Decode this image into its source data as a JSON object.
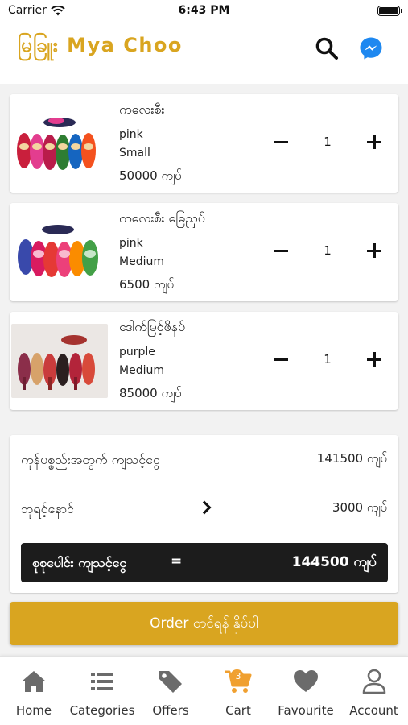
{
  "status_bar": {
    "carrier": "Carrier",
    "time": "6:43 PM"
  },
  "header": {
    "title": "မြခြူး Mya Choo"
  },
  "cart_items": [
    {
      "name": "ကလေးစီး",
      "color": "pink",
      "size": "Small",
      "price": "50000 ကျပ်",
      "quantity": "1"
    },
    {
      "name": "ကလေးစီး ခြေညှပ်",
      "color": "pink",
      "size": "Medium",
      "price": "6500 ကျပ်",
      "quantity": "1"
    },
    {
      "name": "ဒေါက်မြင့်ဖိနပ်",
      "color": "purple",
      "size": "Medium",
      "price": "85000 ကျပ်",
      "quantity": "1"
    }
  ],
  "summary": {
    "subtotal_label": "ကုန်ပစ္စည်းအတွက် ကျသင့်ငွေ",
    "subtotal_value": "141500 ကျပ်",
    "delivery_label": "ဘုရင့်နောင်",
    "delivery_value": "3000 ကျပ်",
    "total_label": "စုစုပေါင်း ကျသင့်ငွေ",
    "total_equals": "=",
    "total_value": "144500 ကျပ်"
  },
  "order_button": {
    "label": "Order တင်ရန် နှိပ်ပါ"
  },
  "tabs": [
    {
      "label": "Home",
      "icon": "home-icon"
    },
    {
      "label": "Categories",
      "icon": "list-icon"
    },
    {
      "label": "Offers",
      "icon": "tag-icon"
    },
    {
      "label": "Cart",
      "icon": "cart-icon",
      "badge": "3"
    },
    {
      "label": "Favourite",
      "icon": "heart-icon"
    },
    {
      "label": "Account",
      "icon": "user-icon"
    }
  ],
  "colors": {
    "accent": "#d9a520",
    "messenger": "#1e88f0",
    "tab_inactive": "#6b6b6b",
    "total_bg": "#1c1c1c"
  }
}
